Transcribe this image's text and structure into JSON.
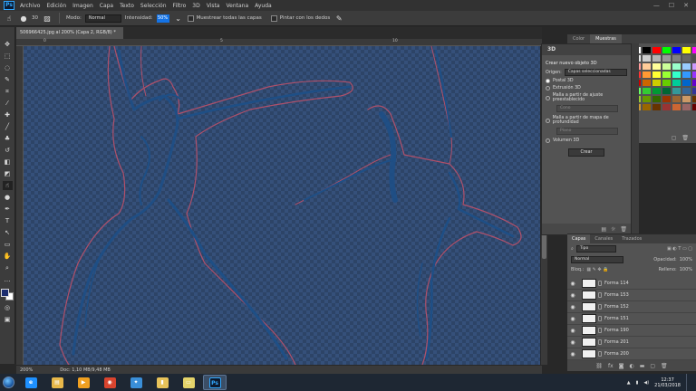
{
  "app": {
    "logo": "Ps"
  },
  "menu": [
    "Archivo",
    "Edición",
    "Imagen",
    "Capa",
    "Texto",
    "Selección",
    "Filtro",
    "3D",
    "Vista",
    "Ventana",
    "Ayuda"
  ],
  "window_controls": {
    "minimize": "—",
    "maximize": "☐",
    "close": "✕"
  },
  "options": {
    "brush_size": "30",
    "mode_label": "Modo:",
    "mode_value": "Normal",
    "intensity_label": "Intensidad:",
    "intensity_value": "50%",
    "sample_all_layers": "Muestrear todas las capas",
    "finger_paint": "Pintar con los dedos"
  },
  "document": {
    "tab_title": "506966425.jpg al 200% (Capa 2, RGB/8) *",
    "zoom": "200%",
    "doc_size": "Doc: 1,10 MB/9,48 MB",
    "ruler_marks": [
      "0",
      "5",
      "10"
    ]
  },
  "panel_3d": {
    "title": "3D",
    "create_label": "Crear nuevo objeto 3D",
    "origin_label": "Origen:",
    "origin_value": "Capas seleccionadas",
    "options": [
      {
        "label": "Postal 3D",
        "selected": true
      },
      {
        "label": "Extrusión 3D",
        "selected": false
      },
      {
        "label": "Malla a partir de ajuste preestablecido",
        "selected": false
      },
      {
        "label": "Malla a partir de mapa de profundidad",
        "selected": false
      },
      {
        "label": "Volumen 3D",
        "selected": false
      }
    ],
    "preset_value": "Cono",
    "depth_value": "Plano",
    "create_button": "Crear"
  },
  "swatches": {
    "tabs": [
      "Color",
      "Muestras"
    ],
    "active_tab": "Muestras",
    "colors": [
      "#ffffff",
      "#000000",
      "#ff0000",
      "#00ff00",
      "#0000ff",
      "#ffff00",
      "#ff00ff",
      "#e6e6e6",
      "#cccccc",
      "#b3b3b3",
      "#999999",
      "#808080",
      "#666666",
      "#4d4d4d",
      "#ff9999",
      "#ffcc99",
      "#ffff99",
      "#ccff99",
      "#99ffcc",
      "#99ccff",
      "#cc99ff",
      "#ff3333",
      "#ff9933",
      "#ffff33",
      "#99ff33",
      "#33ffcc",
      "#3399ff",
      "#9933ff",
      "#cc0000",
      "#cc6600",
      "#cccc00",
      "#66cc00",
      "#00cc99",
      "#0066cc",
      "#6600cc",
      "#66ff66",
      "#33cc33",
      "#009933",
      "#006633",
      "#339999",
      "#336699",
      "#333399",
      "#99cc33",
      "#669900",
      "#336600",
      "#993300",
      "#996633",
      "#cc9966",
      "#663300",
      "#cc9933",
      "#996600",
      "#663300",
      "#993333",
      "#cc6633",
      "#996666",
      "#660000"
    ]
  },
  "layers": {
    "tabs": [
      "Capas",
      "Canales",
      "Trazados"
    ],
    "active_tab": "Capas",
    "filter": "Tipo",
    "blend_mode": "Normal",
    "opacity_label": "Opacidad:",
    "opacity_value": "100%",
    "lock_label": "Bloq.:",
    "fill_label": "Relleno:",
    "fill_value": "100%",
    "items": [
      "Forma 114",
      "Forma 153",
      "Forma 152",
      "Forma 151",
      "Forma 190",
      "Forma 201",
      "Forma 200"
    ]
  },
  "taskbar": {
    "apps": [
      {
        "name": "Internet Explorer",
        "icon": "e",
        "color": "#1e90ff"
      },
      {
        "name": "Explorador",
        "icon": "▤",
        "color": "#e8b84a"
      },
      {
        "name": "Media",
        "icon": "▶",
        "color": "#f0a020"
      },
      {
        "name": "Chrome",
        "icon": "◉",
        "color": "#d9442e"
      },
      {
        "name": "App",
        "icon": "✦",
        "color": "#3a8fd9"
      },
      {
        "name": "Carpeta",
        "icon": "▮",
        "color": "#e8c35a"
      },
      {
        "name": "Notas",
        "icon": "▭",
        "color": "#e4d36a"
      },
      {
        "name": "Photoshop",
        "icon": "Ps",
        "color": "#0d1a2e",
        "active": true
      }
    ],
    "time": "12:37",
    "date": "21/03/2018"
  }
}
